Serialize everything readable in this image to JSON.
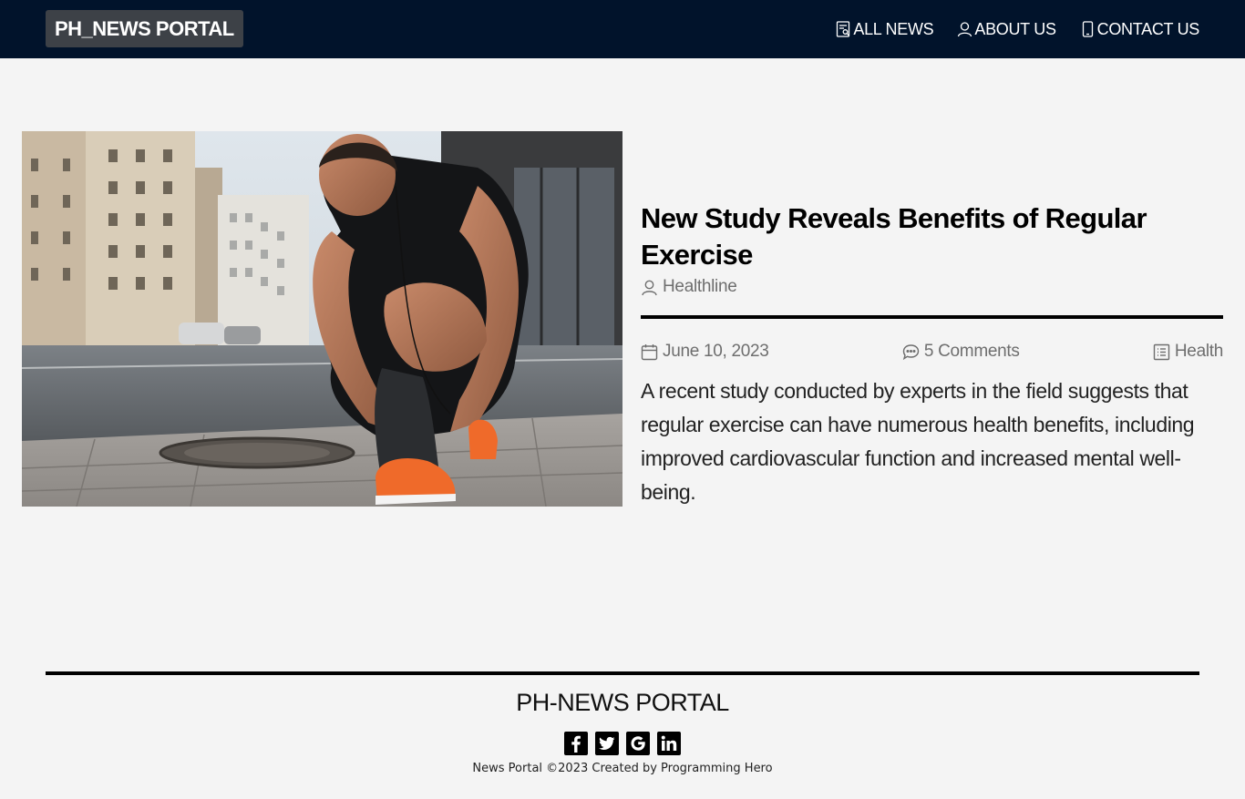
{
  "navbar": {
    "brand": "PH_NEWS PORTAL",
    "links": [
      {
        "label": "ALL NEWS",
        "icon": "news-icon"
      },
      {
        "label": "ABOUT US",
        "icon": "user-icon"
      },
      {
        "label": "CONTACT US",
        "icon": "phone-icon"
      }
    ]
  },
  "article": {
    "image_alt": "athlete-tying-shoe-photo",
    "title": "New Study Reveals Benefits of Regular Exercise",
    "author": "Healthline",
    "date": "June 10, 2023",
    "comments": "5 Comments",
    "category": "Health",
    "description": "A recent study conducted by experts in the field suggests that regular exercise can have numerous health benefits, including improved cardiovascular function and increased mental well-being."
  },
  "footer": {
    "brand": "PH-NEWS PORTAL",
    "socials": [
      "facebook-icon",
      "twitter-icon",
      "google-icon",
      "linkedin-icon"
    ],
    "copyright": "News Portal ©2023 Created by Programming Hero"
  },
  "colors": {
    "navbar_bg": "#01132b",
    "brand_bg": "#3d4147",
    "page_bg": "#f4f4f4",
    "muted_text": "#6e6e6e"
  }
}
